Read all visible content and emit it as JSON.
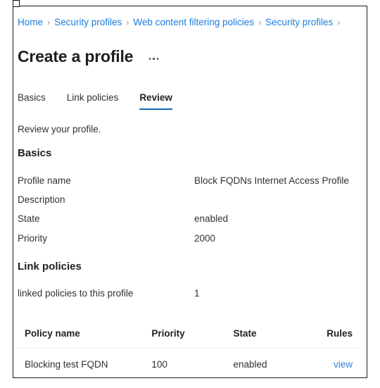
{
  "breadcrumb": {
    "separator": "›",
    "items": [
      {
        "label": "Home"
      },
      {
        "label": "Security profiles"
      },
      {
        "label": "Web content filtering policies"
      },
      {
        "label": "Security profiles"
      }
    ],
    "trailing_separator": "›"
  },
  "header": {
    "title": "Create a profile",
    "more_options_label": "···"
  },
  "tabs": [
    {
      "label": "Basics",
      "active": false
    },
    {
      "label": "Link policies",
      "active": false
    },
    {
      "label": "Review",
      "active": true
    }
  ],
  "intro": {
    "text": "Review your profile."
  },
  "sections": {
    "basics": {
      "heading": "Basics",
      "rows": [
        {
          "key": "Profile name",
          "value": "Block FQDNs Internet Access Profile"
        },
        {
          "key": "Description",
          "value": ""
        },
        {
          "key": "State",
          "value": "enabled"
        },
        {
          "key": "Priority",
          "value": "2000"
        }
      ]
    },
    "link_policies": {
      "heading": "Link policies",
      "summary": {
        "key": "linked policies to this profile",
        "value": "1"
      },
      "table": {
        "columns": [
          "Policy name",
          "Priority",
          "State",
          "Rules"
        ],
        "rows": [
          {
            "policy_name": "Blocking test FQDN",
            "priority": "100",
            "state": "enabled",
            "rules": "view"
          }
        ]
      }
    }
  },
  "colors": {
    "link": "#1a7ddb",
    "accent": "#0f6cbd",
    "text": "#323130",
    "heading": "#201f1e",
    "divider": "#edebe9",
    "frame": "#1a1a1a"
  }
}
